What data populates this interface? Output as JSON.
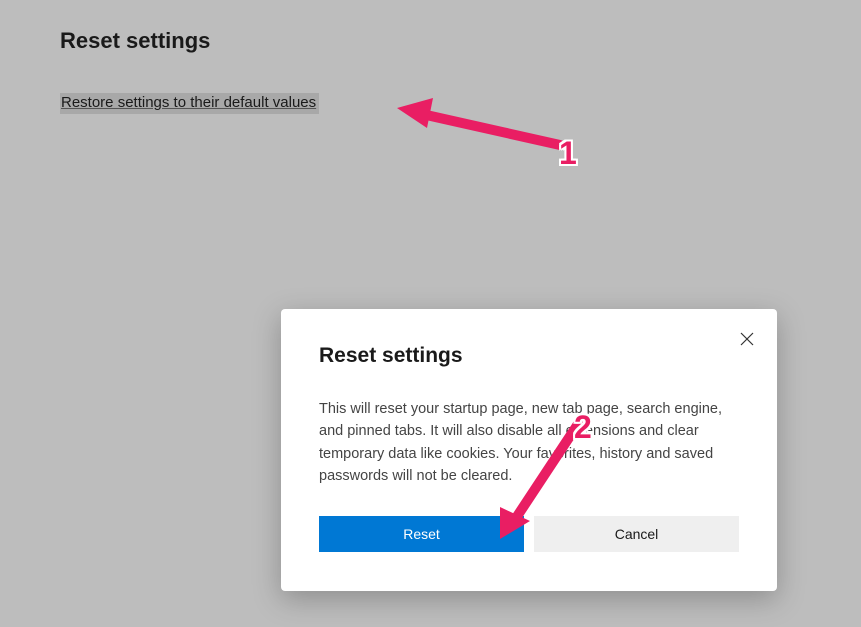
{
  "page": {
    "title": "Reset settings",
    "restore_link": "Restore settings to their default values"
  },
  "dialog": {
    "title": "Reset settings",
    "body": "This will reset your startup page, new tab page, search engine, and pinned tabs. It will also disable all extensions and clear temporary data like cookies. Your favorites, history and saved passwords will not be cleared.",
    "reset_label": "Reset",
    "cancel_label": "Cancel"
  },
  "annotations": {
    "label_1": "1",
    "label_2": "2"
  }
}
